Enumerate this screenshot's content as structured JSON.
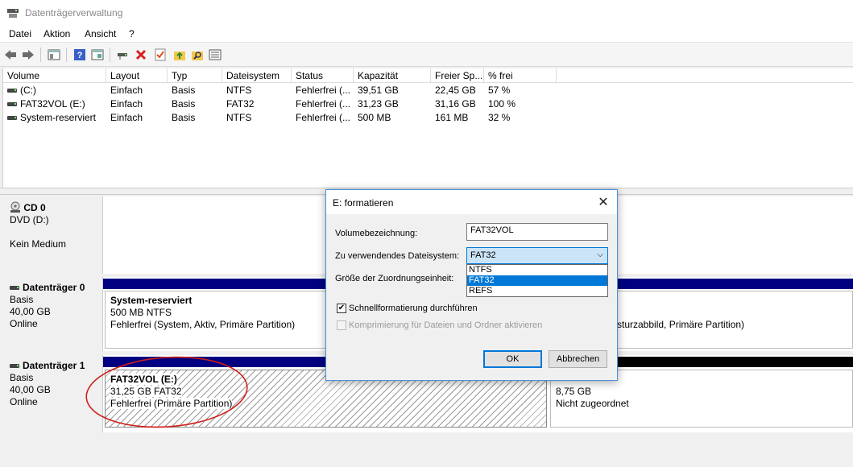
{
  "window": {
    "title": "Datenträgerverwaltung"
  },
  "menu": [
    "Datei",
    "Aktion",
    "Ansicht",
    "?"
  ],
  "toolbar": {
    "icons": [
      "back-icon",
      "forward-icon",
      "show-hide-console-tree-icon",
      "help-icon",
      "properties-view-icon",
      "connect-drive-icon",
      "delete-icon",
      "check-icon",
      "folder-up-icon",
      "search-folder-icon",
      "details-icon"
    ]
  },
  "volume_list": {
    "columns": [
      "Volume",
      "Layout",
      "Typ",
      "Dateisystem",
      "Status",
      "Kapazität",
      "Freier Sp...",
      "% frei"
    ],
    "rows": [
      [
        "(C:)",
        "Einfach",
        "Basis",
        "NTFS",
        "Fehlerfrei (...",
        "39,51 GB",
        "22,45 GB",
        "57 %"
      ],
      [
        "FAT32VOL (E:)",
        "Einfach",
        "Basis",
        "FAT32",
        "Fehlerfrei (...",
        "31,23 GB",
        "31,16 GB",
        "100 %"
      ],
      [
        "System-reserviert",
        "Einfach",
        "Basis",
        "NTFS",
        "Fehlerfrei (...",
        "500 MB",
        "161 MB",
        "32 %"
      ]
    ]
  },
  "disks": {
    "cd0": {
      "name": "CD 0",
      "line1": "DVD (D:)",
      "line2": "Kein Medium"
    },
    "disk0": {
      "name": "Datenträger 0",
      "type": "Basis",
      "size": "40,00 GB",
      "state": "Online",
      "p1": {
        "title": "System-reserviert",
        "size": "500 MB NTFS",
        "status": "Fehlerfrei (System, Aktiv, Primäre Partition)"
      },
      "p2": {
        "status_fragment": "sturzabbild, Primäre Partition)"
      }
    },
    "disk1": {
      "name": "Datenträger 1",
      "type": "Basis",
      "size": "40,00 GB",
      "state": "Online",
      "p1": {
        "title": "FAT32VOL  (E:)",
        "size": "31,25 GB FAT32",
        "status": "Fehlerfrei (Primäre Partition)"
      },
      "p2": {
        "size": "8,75 GB",
        "status": "Nicht zugeordnet"
      }
    },
    "colors": {
      "primary_bar": "#000080",
      "unallocated_bar": "#000000",
      "highlight_ellipse": "#d0201a"
    }
  },
  "dialog": {
    "title": "E: formatieren",
    "volume_label_caption": "Volumebezeichnung:",
    "volume_label_value": "FAT32VOL",
    "filesystem_caption": "Zu verwendendes Dateisystem:",
    "filesystem_value": "FAT32",
    "filesystem_options": [
      "NTFS",
      "FAT32",
      "REFS"
    ],
    "filesystem_selected_index": 1,
    "allocation_caption": "Größe der Zuordnungseinheit:",
    "quick_format_label": "Schnellformatierung durchführen",
    "quick_format_checked": true,
    "compression_label": "Komprimierung für Dateien und Ordner aktivieren",
    "compression_checked": false,
    "ok_label": "OK",
    "cancel_label": "Abbrechen"
  }
}
